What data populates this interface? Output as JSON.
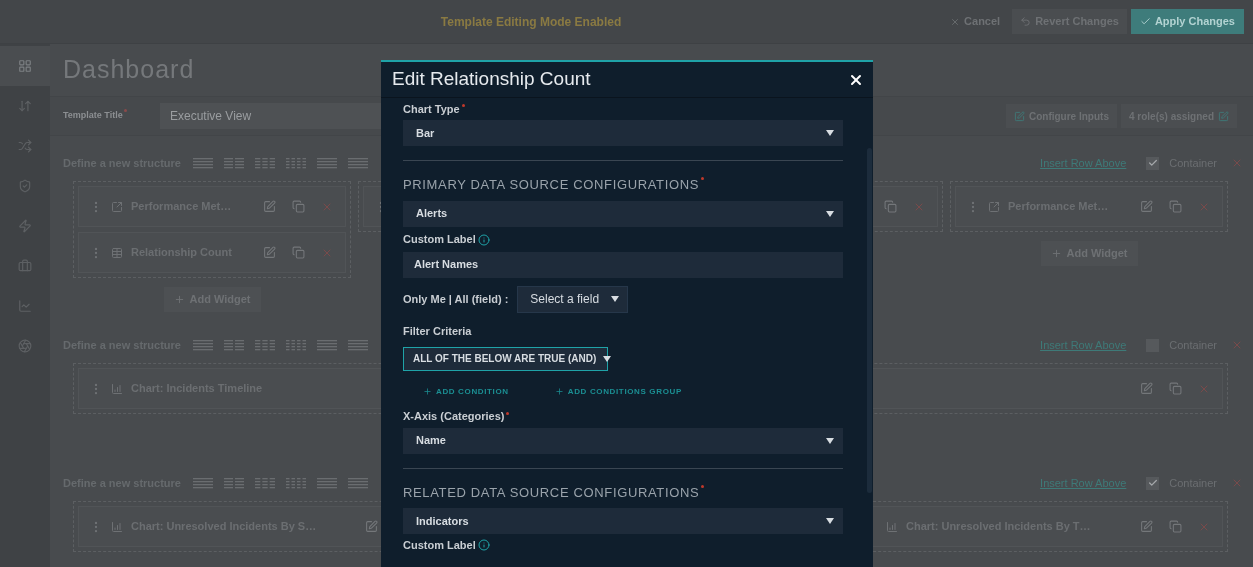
{
  "top_bar": {
    "title": "Template Editing Mode Enabled",
    "actions": [
      {
        "kind": "cancel",
        "label": "Cancel"
      },
      {
        "kind": "revert",
        "label": "Revert Changes"
      },
      {
        "kind": "apply",
        "label": "Apply Changes"
      }
    ]
  },
  "sidebar": {
    "items": [
      {
        "kind": "dashboard",
        "selected": true
      },
      {
        "kind": "sort",
        "selected": false
      },
      {
        "kind": "shuffle",
        "selected": false
      },
      {
        "kind": "shield",
        "selected": false
      },
      {
        "kind": "bolt",
        "selected": false
      },
      {
        "kind": "briefcase",
        "selected": false
      },
      {
        "kind": "chart",
        "selected": false
      },
      {
        "kind": "gear",
        "selected": false
      }
    ]
  },
  "page": {
    "title": "Dashboard",
    "template_title": {
      "label": "Template Title",
      "required": true,
      "value": "Executive View"
    },
    "buttons": [
      {
        "kind": "configure",
        "label": "Configure Inputs"
      },
      {
        "kind": "roles",
        "label": "4 role(s) assigned"
      }
    ]
  },
  "structures": [
    {
      "kind": "wide_middle",
      "label": "Define a new structure",
      "insert_link": "Insert Row Above",
      "container": {
        "label": "Container",
        "checked": true
      },
      "columns": [
        {
          "widgets": [
            {
              "kind": "kpi",
              "title": "Performance Met…"
            },
            {
              "kind": "table",
              "title": "Relationship Count"
            }
          ],
          "add_widget": "Add Widget"
        },
        {
          "widgets": [
            {
              "kind": "covered"
            }
          ]
        },
        {
          "widgets": [
            {
              "kind": "kpi",
              "title": "Performance Met…"
            }
          ],
          "add_widget": "Add Widget"
        }
      ]
    },
    {
      "kind": "full",
      "label": "Define a new structure",
      "insert_link": "Insert Row Above",
      "container": {
        "label": "Container",
        "checked": false
      },
      "columns": [
        {
          "widgets": [
            {
              "kind": "chart",
              "title": "Chart: Incidents Timeline"
            }
          ]
        }
      ]
    },
    {
      "kind": "sides",
      "label": "Define a new structure",
      "insert_link": "Insert Row Above",
      "container": {
        "label": "Container",
        "checked": true
      },
      "columns": [
        {
          "widgets": [
            {
              "kind": "chart",
              "title": "Chart: Unresolved Incidents By S…"
            }
          ]
        },
        {
          "widgets": [
            {
              "kind": "chart",
              "title": "Chart: Unresolved Incidents By T…"
            }
          ]
        }
      ]
    }
  ],
  "dialog": {
    "title": "Edit Relationship Count",
    "fields": [
      {
        "kind": "select",
        "label": "Chart Type",
        "required": true,
        "value": "Bar"
      },
      {
        "kind": "divider"
      },
      {
        "kind": "heading",
        "label": "PRIMARY DATA SOURCE CONFIGURATIONS",
        "required": true
      },
      {
        "kind": "select",
        "value": "Alerts"
      },
      {
        "kind": "input",
        "label": "Custom Label",
        "info": true,
        "value": "Alert Names"
      },
      {
        "kind": "inline_select",
        "label": "Only Me | All (field) :",
        "value": "Select a field"
      },
      {
        "kind": "filter",
        "label": "Filter Criteria",
        "value": "ALL OF THE BELOW ARE TRUE (AND)",
        "links": [
          "ADD CONDITION",
          "ADD CONDITIONS GROUP"
        ]
      },
      {
        "kind": "select",
        "label": "X-Axis (Categories)",
        "required": true,
        "value": "Name"
      },
      {
        "kind": "divider"
      },
      {
        "kind": "heading",
        "label": "RELATED DATA SOURCE CONFIGURATIONS",
        "required": true
      },
      {
        "kind": "select",
        "value": "Indicators"
      },
      {
        "kind": "label",
        "label": "Custom Label",
        "info": true
      }
    ]
  }
}
